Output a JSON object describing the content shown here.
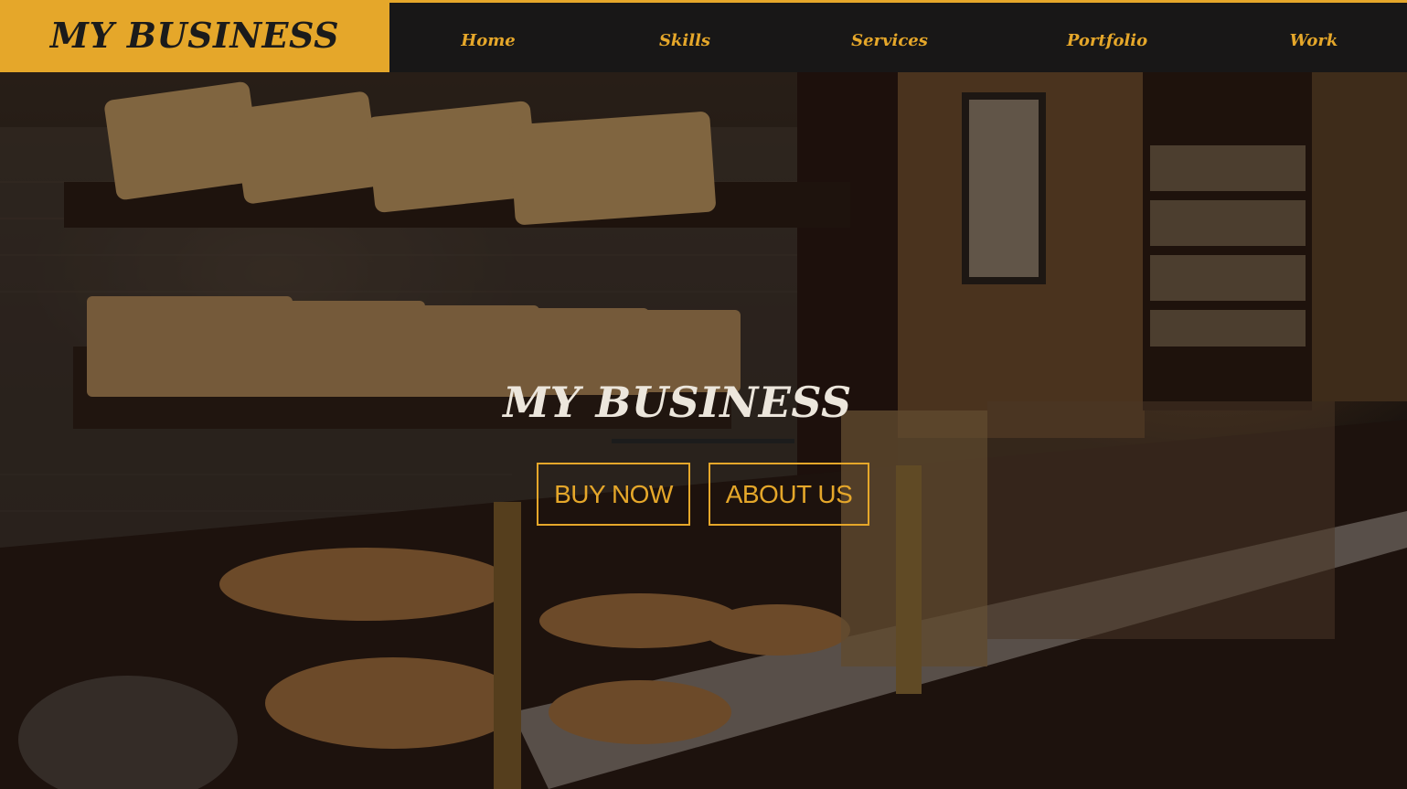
{
  "header": {
    "brand": "MY BUSINESS",
    "nav": [
      {
        "label": "Home"
      },
      {
        "label": "Skills"
      },
      {
        "label": "Services"
      },
      {
        "label": "Portfolio"
      },
      {
        "label": "Work"
      }
    ]
  },
  "hero": {
    "title": "MY BUSINESS",
    "buttons": {
      "buy": "BUY NOW",
      "about": "ABOUT US"
    },
    "background": "bakery-interior-photo"
  },
  "colors": {
    "accent": "#e5a72a",
    "nav_background": "#181717",
    "hero_text": "#ece6dc"
  }
}
